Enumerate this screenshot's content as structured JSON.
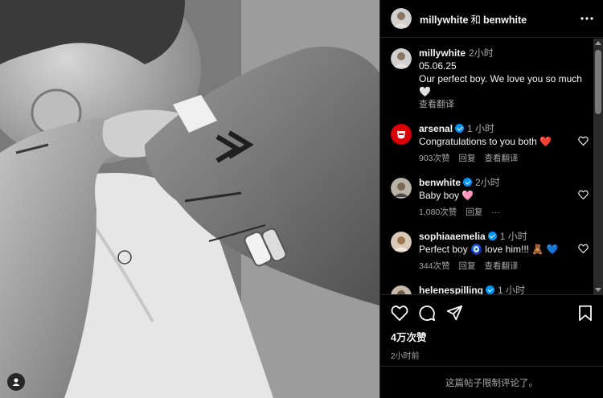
{
  "header": {
    "user1": "millywhite",
    "and": "和",
    "user2": "benwhite"
  },
  "caption": {
    "username": "millywhite",
    "time": "2小时",
    "date": "05.06.25",
    "text": "Our perfect boy. We love you so much 🤍",
    "translate": "查看翻译"
  },
  "comments": [
    {
      "username": "arsenal",
      "time": "1 小时",
      "text": "Congratulations to you both ❤️",
      "likes": "903次赞",
      "reply": "回复",
      "translate": "查看翻译"
    },
    {
      "username": "benwhite",
      "time": "2小时",
      "text": "Baby boy 🩷",
      "likes": "1,080次赞",
      "reply": "回复",
      "more": "···"
    },
    {
      "username": "sophiaaemelia",
      "time": "1 小时",
      "text": "Perfect boy 🧿 love him!!! 🧸 💙",
      "likes": "344次赞",
      "reply": "回复",
      "translate": "查看翻译"
    },
    {
      "username": "helenespilling",
      "time": "1 小时"
    }
  ],
  "footer": {
    "likes": "4万次赞",
    "time": "2小时前",
    "restricted": "这篇帖子限制评论了。"
  },
  "colors": {
    "background": "#000000",
    "muted": "#a8a8a8",
    "verified": "#0095f6",
    "arsenal_red": "#db0007"
  }
}
